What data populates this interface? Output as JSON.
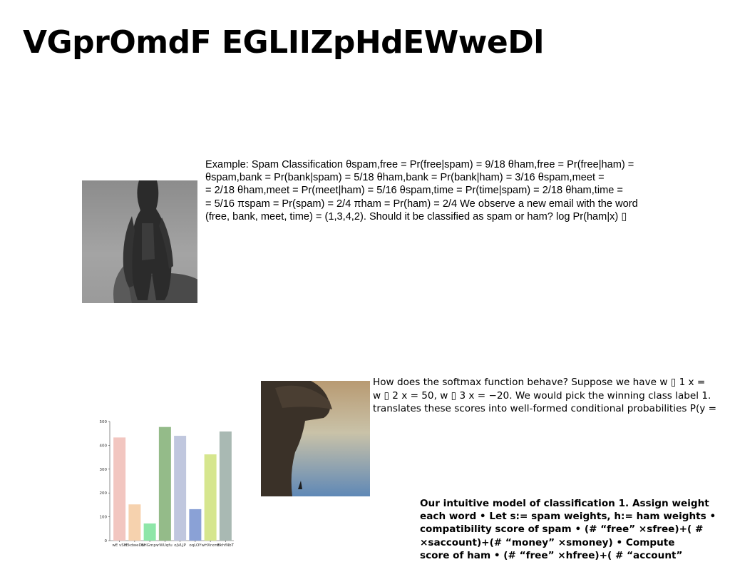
{
  "page": {
    "title": "VGprOmdF EGLIIZpHdEWweDl"
  },
  "block1": {
    "lines": [
      "Example: Spam Classification θspam,free = Pr(free|spam) = 9/18 θham,free = Pr(free|ham) =",
      "θspam,bank = Pr(bank|spam) = 5/18 θham,bank = Pr(bank|ham) = 3/16 θspam,meet =",
      "= 2/18 θham,meet = Pr(meet|ham) = 5/16 θspam,time = Pr(time|spam) = 2/18 θham,time =",
      "= 5/16 πspam = Pr(spam) = 2/4 πham = Pr(ham) = 2/4 We observe a new email with the word",
      "(free, bank, meet, time) = (1,3,4,2). Should it be classified as spam or ham? log Pr(ham|x) ▯"
    ]
  },
  "block2": {
    "lines": [
      "How does the softmax function behave? Suppose we have w ▯ 1 x =",
      "w ▯ 2 x = 50, w ▯ 3 x = −20. We would pick the winning class label 1.",
      "translates these scores into well-formed conditional probabilities P(y ="
    ]
  },
  "block3": {
    "lines": [
      "Our intuitive model of classification 1. Assign weight",
      "each word • Let s:= spam weights, h:= ham weights •",
      "compatibility score of spam • (# “free” ×sfree)+( #",
      "×saccount)+(# “money” ×smoney) • Compute",
      "score of ham • (# “free” ×hfree)+( # “account”"
    ]
  },
  "images": {
    "photo1": "fashion-figure-photo",
    "photo2": "hat-silhouette-photo"
  },
  "chart_data": {
    "type": "bar",
    "categories": [
      "wE vSH",
      "IEkdweDN",
      "bHGmpv",
      "rWUqfu",
      "ojVLJP",
      "oqLOY",
      "wHXrxmt",
      "BkhfNbT"
    ],
    "values": [
      433,
      152,
      72,
      477,
      440,
      132,
      362,
      458
    ],
    "colors": [
      "#f2c6c0",
      "#f6d2ae",
      "#8ee6a8",
      "#94bb89",
      "#c0c7de",
      "#8aa1d6",
      "#d6e68e",
      "#a9b9b3"
    ],
    "ylim": [
      0,
      500
    ],
    "yticks": [
      0,
      100,
      200,
      300,
      400,
      500
    ],
    "title": "",
    "xlabel": "",
    "ylabel": "",
    "grid": false,
    "legend": "none"
  }
}
